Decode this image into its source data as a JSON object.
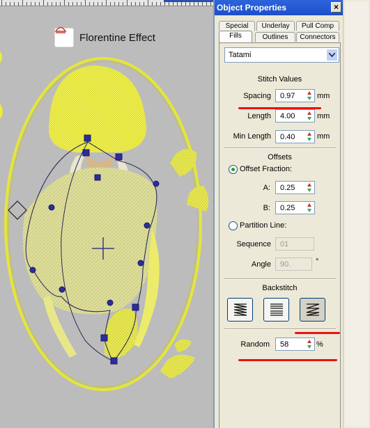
{
  "canvas": {
    "effect_label": "Florentine Effect",
    "effect_icon": "florentine-effect-icon"
  },
  "panel": {
    "title": "Object Properties",
    "close_label": "×",
    "tabs_row1": [
      "Special",
      "Underlay",
      "Pull Comp"
    ],
    "tabs_row2": [
      "Fills",
      "Outlines",
      "Connectors"
    ],
    "active_tab": "Fills",
    "fill_type": "Tatami",
    "stitch_values": {
      "title": "Stitch Values",
      "spacing_label": "Spacing",
      "spacing_value": "0.97",
      "length_label": "Length",
      "length_value": "4.00",
      "min_length_label": "Min Length",
      "min_length_value": "0.40",
      "unit": "mm"
    },
    "offsets": {
      "title": "Offsets",
      "offset_fraction_label": "Offset Fraction:",
      "a_label": "A:",
      "a_value": "0.25",
      "b_label": "B:",
      "b_value": "0.25",
      "partition_line_label": "Partition Line:",
      "sequence_label": "Sequence",
      "sequence_value": "01",
      "angle_label": "Angle",
      "angle_value": "90.",
      "angle_unit": "°"
    },
    "backstitch": {
      "title": "Backstitch",
      "buttons": [
        "backstitch-horizontal-icon",
        "backstitch-stacked-icon",
        "backstitch-zigzag-icon"
      ]
    },
    "random": {
      "label": "Random",
      "value": "58",
      "unit": "%"
    }
  },
  "colors": {
    "embroidery_yellow": "#ecec3c",
    "titlebar_blue": "#1c4fc9",
    "annotation_red": "#e81313",
    "node_blue": "#2c2c9a"
  }
}
